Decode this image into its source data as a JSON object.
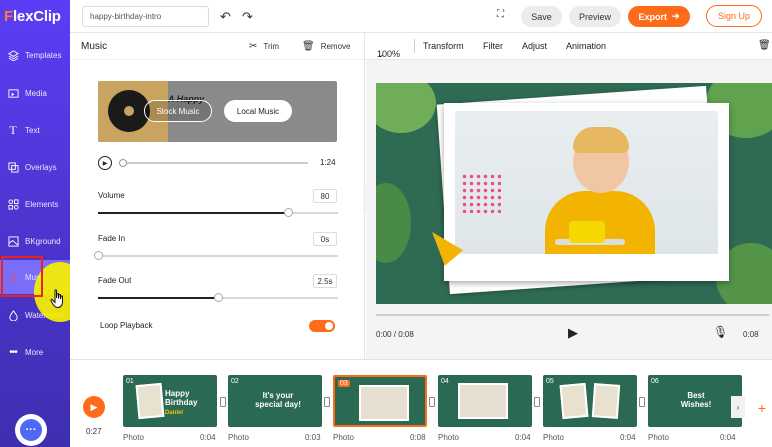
{
  "app": {
    "logo": "FlexClip"
  },
  "sidebar": {
    "items": [
      {
        "label": "Templates",
        "icon": "templates-icon"
      },
      {
        "label": "Media",
        "icon": "media-icon"
      },
      {
        "label": "Text",
        "icon": "text-icon"
      },
      {
        "label": "Overlays",
        "icon": "overlays-icon"
      },
      {
        "label": "Elements",
        "icon": "elements-icon"
      },
      {
        "label": "BKground",
        "icon": "background-icon"
      },
      {
        "label": "Music",
        "icon": "music-icon"
      },
      {
        "label": "Watermark",
        "icon": "watermark-icon"
      },
      {
        "label": "More",
        "icon": "more-icon"
      }
    ],
    "active": "Music"
  },
  "topbar": {
    "project_name": "happy-birthday-intro",
    "save": "Save",
    "preview": "Preview",
    "export": "Export",
    "signup": "Sign Up"
  },
  "music_panel": {
    "title": "Music",
    "trim": "Trim",
    "remove": "Remove",
    "card_text": "A Happy",
    "stock_music": "Stock Music",
    "local_music": "Local Music",
    "duration": "1:24",
    "progress": 0,
    "volume_label": "Volume",
    "volume_value": "80",
    "fade_in_label": "Fade In",
    "fade_in_value": "0s",
    "fade_out_label": "Fade Out",
    "fade_out_value": "2.5s",
    "loop_label": "Loop Playback",
    "loop_on": true
  },
  "preview_toolbar": {
    "zoom": "100%",
    "transform": "Transform",
    "filter": "Filter",
    "adjust": "Adjust",
    "animation": "Animation"
  },
  "player": {
    "time": "0:00 / 0:08",
    "end_time": "0:08"
  },
  "timeline": {
    "total_time": "0:27",
    "clips": [
      {
        "num": "01",
        "label": "Photo",
        "duration": "0:04",
        "title": "Happy Birthday",
        "sub": "Daniel"
      },
      {
        "num": "02",
        "label": "Photo",
        "duration": "0:03",
        "title": "It's your special day!",
        "sub": ""
      },
      {
        "num": "03",
        "label": "Photo",
        "duration": "0:08",
        "title": "",
        "sub": ""
      },
      {
        "num": "04",
        "label": "Photo",
        "duration": "0:04",
        "title": "",
        "sub": ""
      },
      {
        "num": "05",
        "label": "Photo",
        "duration": "0:04",
        "title": "",
        "sub": ""
      },
      {
        "num": "06",
        "label": "Photo",
        "duration": "0:04",
        "title": "Best Wishes!",
        "sub": ""
      }
    ]
  },
  "colors": {
    "accent": "#ff6b1a",
    "sidebar": "#4a34c9",
    "active_highlight": "#e8251c"
  }
}
